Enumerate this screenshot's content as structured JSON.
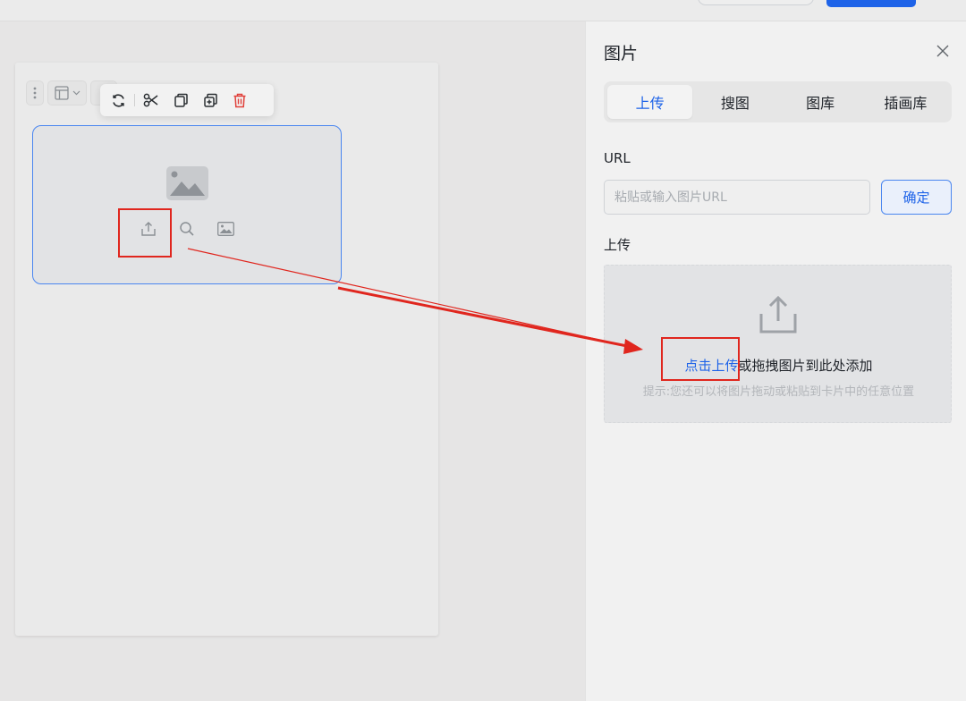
{
  "panel": {
    "title": "图片",
    "tabs": [
      {
        "label": "上传",
        "active": true
      },
      {
        "label": "搜图",
        "active": false
      },
      {
        "label": "图库",
        "active": false
      },
      {
        "label": "插画库",
        "active": false
      }
    ],
    "url_label": "URL",
    "url_placeholder": "粘贴或输入图片URL",
    "url_value": "",
    "confirm_label": "确定",
    "upload_label": "上传",
    "dropzone": {
      "link_text": "点击上传",
      "rest_text": "或拖拽图片到此处添加",
      "hint": "提示:您还可以将图片拖动或粘贴到卡片中的任意位置"
    }
  },
  "canvas": {
    "toolbar_icons": [
      "rotate-icon",
      "scissors-icon",
      "copy-icon",
      "duplicate-icon",
      "delete-icon"
    ],
    "image_block_icons": [
      "upload-icon",
      "search-icon",
      "image-icon"
    ]
  },
  "colors": {
    "accent": "#1e63e8",
    "annotation": "#e0261e",
    "delete": "#e0403a"
  }
}
